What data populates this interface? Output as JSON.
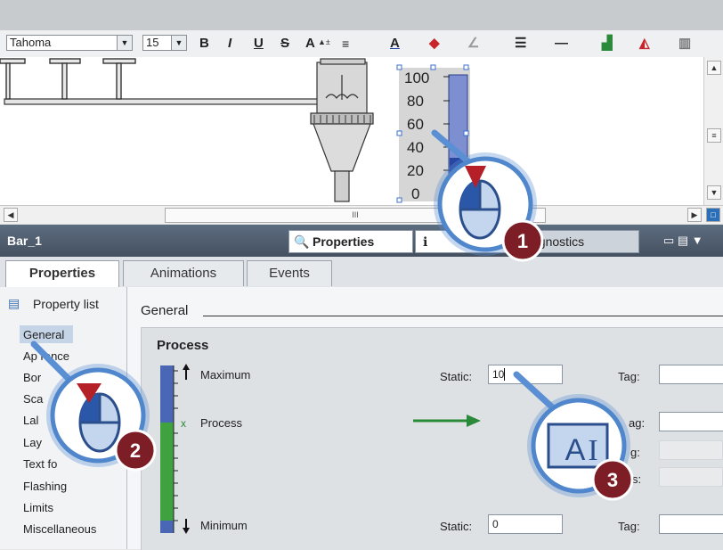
{
  "toolbar": {
    "font_name": "Tahoma",
    "font_size": "15",
    "bold": "B",
    "italic": "I",
    "underline": "U",
    "strike": "S",
    "font_grow": "A",
    "text_color": "A"
  },
  "canvas": {
    "scale_labels": [
      "100",
      "80",
      "60",
      "40",
      "20",
      "0"
    ],
    "bar_fill_fraction": 0.33
  },
  "scroll": {
    "center_mark": "III"
  },
  "inspector": {
    "object_name": "Bar_1",
    "tabs": [
      "Properties",
      "Info",
      "Diagnostics"
    ],
    "tab_properties": "Properties",
    "tab_diagnostics": "agnostics"
  },
  "property_tabs": [
    "Properties",
    "Animations",
    "Events"
  ],
  "property_list_label": "Property list",
  "nav_items": [
    "General",
    "Ap    rance",
    "Bor",
    "Sca",
    "Lal",
    "Lay",
    "Text fo",
    "Flashing",
    "Limits",
    "Miscellaneous"
  ],
  "general_section_title": "General",
  "process_group": {
    "title": "Process",
    "maximum_label": "Maximum",
    "process_label": "Process",
    "minimum_label": "Minimum",
    "static_label": "Static:",
    "tag_label": "Tag:",
    "max_static_value": "10",
    "min_static_value": "0",
    "partial_labels": [
      "ag:",
      "g:",
      "s:"
    ]
  },
  "callouts": [
    "1",
    "2",
    "3"
  ],
  "colors": {
    "callout_ring": "#5b8fd4",
    "callout_badge": "#7d1e26",
    "arrow": "#2a8a3a",
    "bar_blue": "#3556a6",
    "bar_green": "#3fa23f"
  }
}
